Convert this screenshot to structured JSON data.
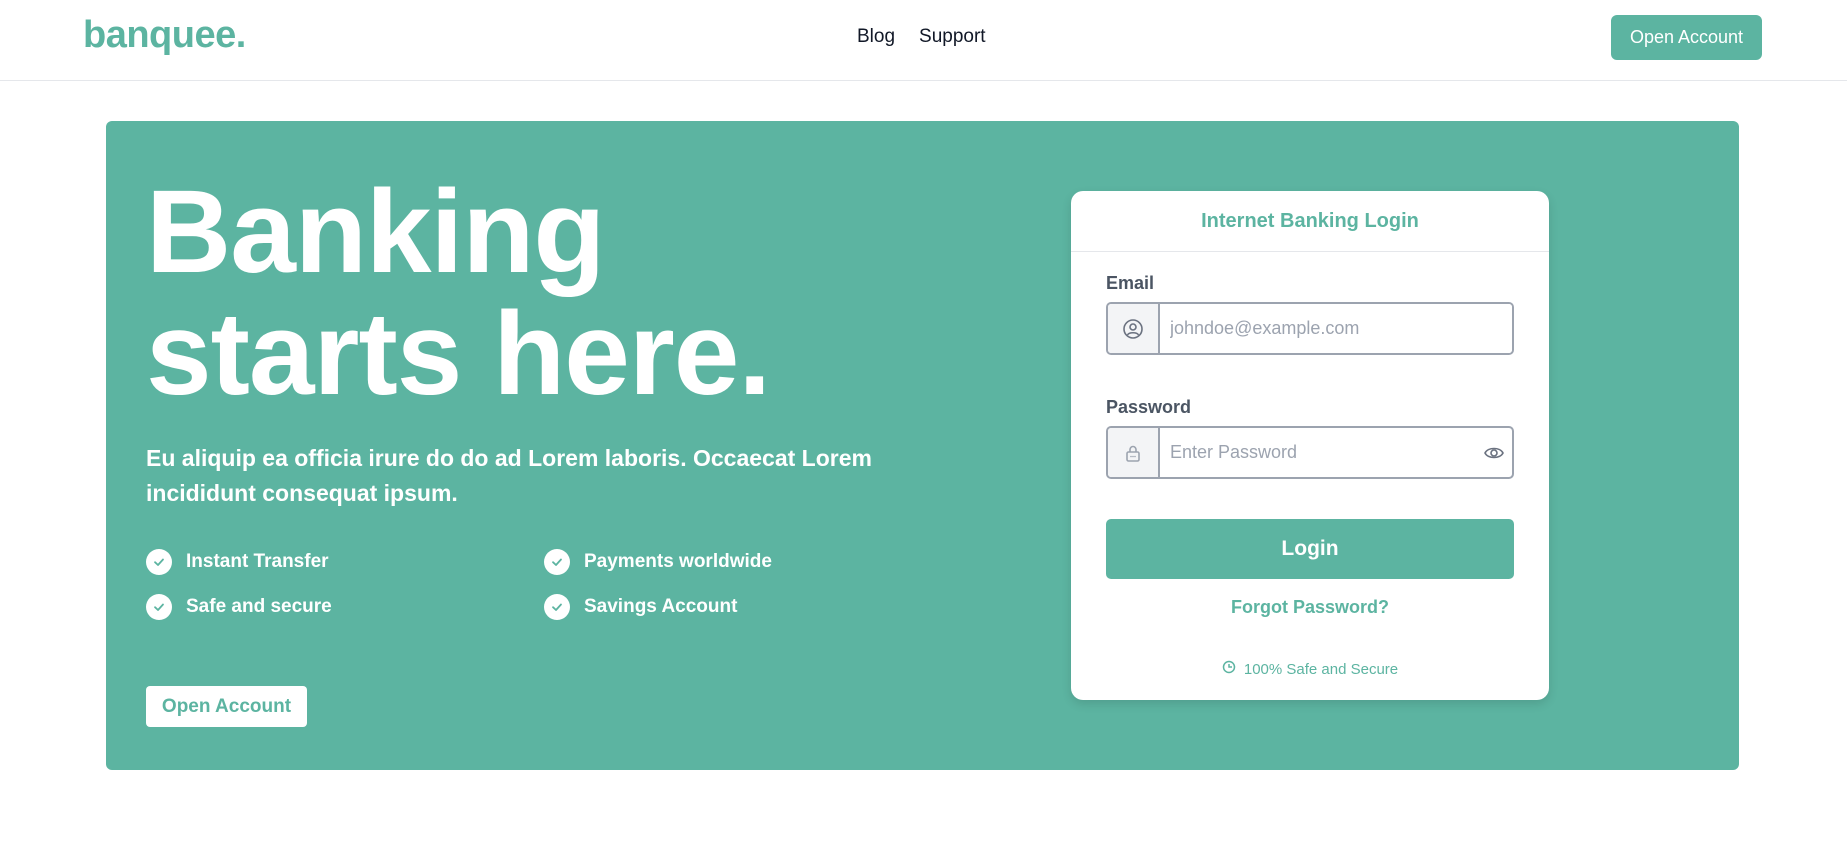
{
  "brand": {
    "logo": "banquee.",
    "accent": "#5cb4a1"
  },
  "nav": {
    "links": [
      "Blog",
      "Support"
    ],
    "cta": "Open Account"
  },
  "hero": {
    "title_line1": "Banking",
    "title_line2": "starts here.",
    "subtitle": "Eu aliquip ea officia irure do do ad Lorem laboris. Occaecat Lorem incididunt consequat ipsum.",
    "features": [
      "Instant Transfer",
      "Payments worldwide",
      "Safe and secure",
      "Savings Account"
    ],
    "cta": "Open Account"
  },
  "login": {
    "title": "Internet Banking Login",
    "email_label": "Email",
    "email_placeholder": "johndoe@example.com",
    "password_label": "Password",
    "password_placeholder": "Enter Password",
    "submit": "Login",
    "forgot": "Forgot Password?",
    "safe_note": "100% Safe and Secure",
    "icons": [
      "user-circle-icon",
      "lock-icon",
      "eye-icon",
      "shield-icon"
    ]
  }
}
